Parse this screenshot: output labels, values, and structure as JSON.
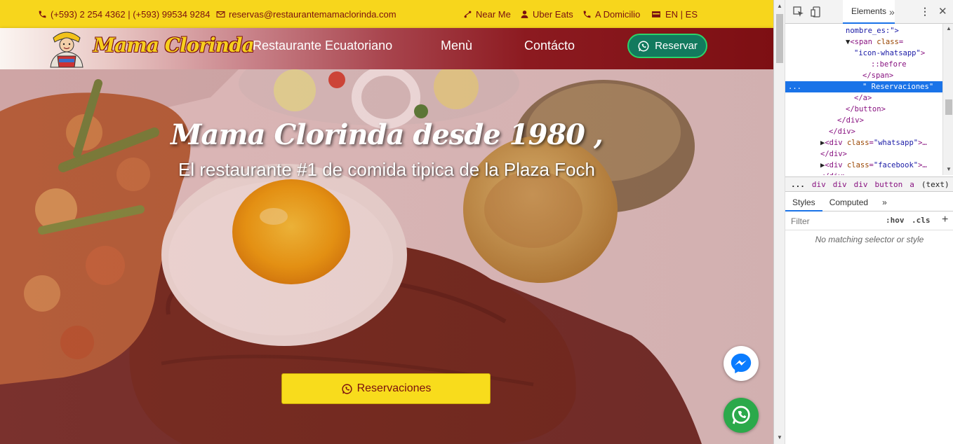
{
  "topbar": {
    "phone": "(+593) 2 254 4362 | (+593) 99534 9284",
    "email": "reservas@restaurantemamaclorinda.com",
    "near_me": "Near Me",
    "uber_eats": "Uber Eats",
    "delivery": "A Domicilio",
    "language": "EN | ES"
  },
  "nav": {
    "logo_text": "Mama Clorinda",
    "links": [
      "Restaurante Ecuatoriano",
      "Menù",
      "Contácto"
    ],
    "reserve_label": "Reservar"
  },
  "hero": {
    "title": "Mama Clorinda desde 1980 ,",
    "subtitle": "El restaurante #1 de comida tipica de la Plaza Foch",
    "button_label": "Reservaciones"
  },
  "devtools": {
    "tab_elements": "Elements",
    "more_tabs": "»",
    "dom_lines": [
      {
        "indent": 86,
        "parts": [
          [
            "t-val",
            "nombre_es:\">"
          ]
        ]
      },
      {
        "indent": 86,
        "parts": [
          [
            "t-txt",
            "▼"
          ],
          [
            "t-tag",
            "<span "
          ],
          [
            "t-attr",
            "class"
          ],
          [
            "t-tag",
            "="
          ]
        ]
      },
      {
        "indent": 98,
        "parts": [
          [
            "t-val",
            "\"icon-whatsapp\""
          ],
          [
            "t-tag",
            ">"
          ]
        ]
      },
      {
        "indent": 122,
        "parts": [
          [
            "t-tag",
            "::before"
          ]
        ]
      },
      {
        "indent": 110,
        "parts": [
          [
            "t-tag",
            "</span>"
          ]
        ]
      },
      {
        "indent": 110,
        "parts": [
          [
            "t-txt",
            "\" Reservaciones\""
          ]
        ],
        "selected": true,
        "dots": "..."
      },
      {
        "indent": 98,
        "parts": [
          [
            "t-tag",
            "</a>"
          ]
        ]
      },
      {
        "indent": 86,
        "parts": [
          [
            "t-tag",
            "</button>"
          ]
        ]
      },
      {
        "indent": 74,
        "parts": [
          [
            "t-tag",
            "</div>"
          ]
        ]
      },
      {
        "indent": 62,
        "parts": [
          [
            "t-tag",
            "</div>"
          ]
        ]
      },
      {
        "indent": 50,
        "parts": [
          [
            "t-txt",
            "▶"
          ],
          [
            "t-tag",
            "<div "
          ],
          [
            "t-attr",
            "class"
          ],
          [
            "t-tag",
            "="
          ],
          [
            "t-val",
            "\"whatsapp\""
          ],
          [
            "t-tag",
            ">…"
          ]
        ]
      },
      {
        "indent": 50,
        "parts": [
          [
            "t-tag",
            "</div>"
          ]
        ]
      },
      {
        "indent": 50,
        "parts": [
          [
            "t-txt",
            "▶"
          ],
          [
            "t-tag",
            "<div "
          ],
          [
            "t-attr",
            "class"
          ],
          [
            "t-tag",
            "="
          ],
          [
            "t-val",
            "\"facebook\""
          ],
          [
            "t-tag",
            ">…"
          ]
        ]
      },
      {
        "indent": 50,
        "parts": [
          [
            "t-tag",
            "</div>"
          ]
        ]
      }
    ],
    "breadcrumbs": [
      "...",
      "div",
      "div",
      "div",
      "button",
      "a",
      "(text)"
    ],
    "style_tabs": [
      "Styles",
      "Computed",
      "»"
    ],
    "filter_placeholder": "Filter",
    "hov": ":hov",
    "cls": ".cls",
    "add": "+",
    "no_match": "No matching selector or style"
  },
  "colors": {
    "topbar": "#f7d61c",
    "brand_red": "#7a1010",
    "whatsapp_green": "#2ba94a",
    "messenger_blue": "#0a7cff"
  }
}
